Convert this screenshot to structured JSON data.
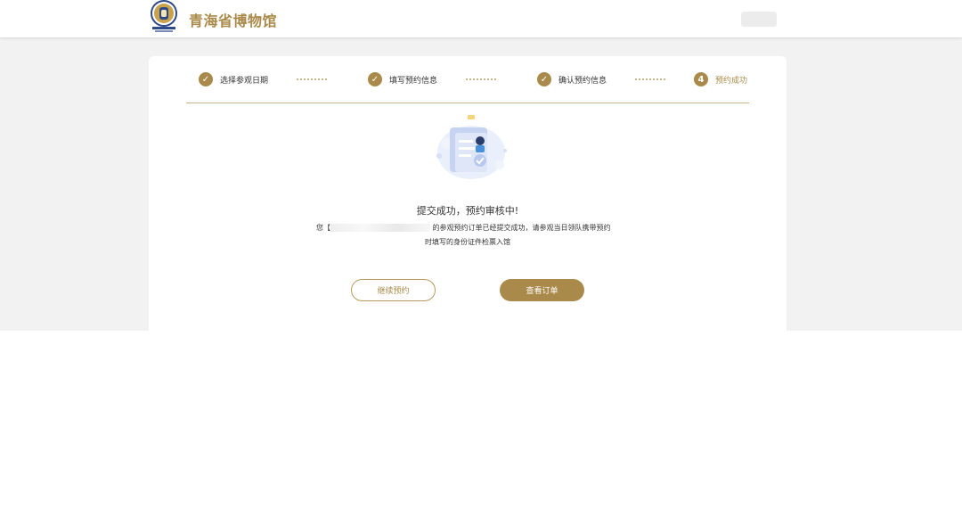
{
  "header": {
    "site_title": "青海省博物馆"
  },
  "steps": [
    {
      "label": "选择参观日期",
      "icon": "check-icon",
      "status": "done"
    },
    {
      "label": "填写预约信息",
      "icon": "check-icon",
      "status": "done"
    },
    {
      "label": "确认预约信息",
      "icon": "check-icon",
      "status": "done"
    },
    {
      "label": "预约成功",
      "number": "4",
      "status": "active"
    }
  ],
  "result": {
    "title": "提交成功，预约审核中!",
    "line1_prefix": "您【",
    "line1_suffix": "的参观预约订单已经提交成功，请参观当日领队携带预约",
    "line2": "时填写的身份证件检票入馆"
  },
  "buttons": {
    "continue_label": "继续预约",
    "view_order_label": "查看订单"
  },
  "colors": {
    "accent": "#a98a4a",
    "accent_light": "#c9b58a",
    "page_band": "#f2f2f2"
  }
}
